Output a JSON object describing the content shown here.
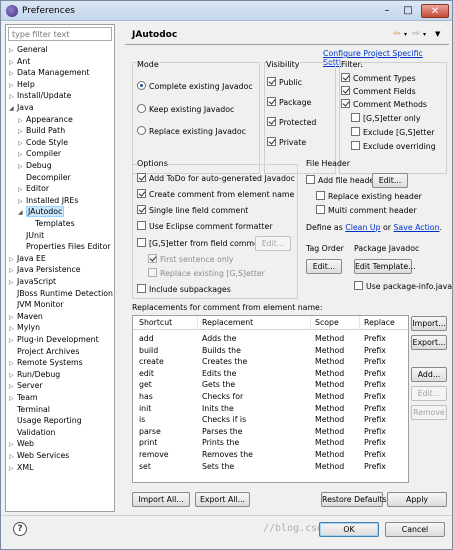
{
  "window": {
    "title": "Preferences"
  },
  "filter": {
    "placeholder": "type filter text"
  },
  "tree": [
    {
      "label": "General",
      "arrow": "▷",
      "indent": 0
    },
    {
      "label": "Ant",
      "arrow": "▷",
      "indent": 0
    },
    {
      "label": "Data Management",
      "arrow": "▷",
      "indent": 0
    },
    {
      "label": "Help",
      "arrow": "▷",
      "indent": 0
    },
    {
      "label": "Install/Update",
      "arrow": "▷",
      "indent": 0
    },
    {
      "label": "Java",
      "arrow": "◢",
      "indent": 0
    },
    {
      "label": "Appearance",
      "arrow": "▷",
      "indent": 1
    },
    {
      "label": "Build Path",
      "arrow": "▷",
      "indent": 1
    },
    {
      "label": "Code Style",
      "arrow": "▷",
      "indent": 1
    },
    {
      "label": "Compiler",
      "arrow": "▷",
      "indent": 1
    },
    {
      "label": "Debug",
      "arrow": "▷",
      "indent": 1
    },
    {
      "label": "Decompiler",
      "arrow": "",
      "indent": 1
    },
    {
      "label": "Editor",
      "arrow": "▷",
      "indent": 1
    },
    {
      "label": "Installed JREs",
      "arrow": "▷",
      "indent": 1
    },
    {
      "label": "JAutodoc",
      "arrow": "◢",
      "indent": 1,
      "selected": true
    },
    {
      "label": "Templates",
      "arrow": "",
      "indent": 2
    },
    {
      "label": "JUnit",
      "arrow": "",
      "indent": 1
    },
    {
      "label": "Properties Files Editor",
      "arrow": "",
      "indent": 1
    },
    {
      "label": "Java EE",
      "arrow": "▷",
      "indent": 0
    },
    {
      "label": "Java Persistence",
      "arrow": "▷",
      "indent": 0
    },
    {
      "label": "JavaScript",
      "arrow": "▷",
      "indent": 0
    },
    {
      "label": "JBoss Runtime Detection",
      "arrow": "",
      "indent": 0
    },
    {
      "label": "JVM Monitor",
      "arrow": "",
      "indent": 0
    },
    {
      "label": "Maven",
      "arrow": "▷",
      "indent": 0
    },
    {
      "label": "Mylyn",
      "arrow": "▷",
      "indent": 0
    },
    {
      "label": "Plug-in Development",
      "arrow": "▷",
      "indent": 0
    },
    {
      "label": "Project Archives",
      "arrow": "",
      "indent": 0
    },
    {
      "label": "Remote Systems",
      "arrow": "▷",
      "indent": 0
    },
    {
      "label": "Run/Debug",
      "arrow": "▷",
      "indent": 0
    },
    {
      "label": "Server",
      "arrow": "▷",
      "indent": 0
    },
    {
      "label": "Team",
      "arrow": "▷",
      "indent": 0
    },
    {
      "label": "Terminal",
      "arrow": "",
      "indent": 0
    },
    {
      "label": "Usage Reporting",
      "arrow": "",
      "indent": 0
    },
    {
      "label": "Validation",
      "arrow": "",
      "indent": 0
    },
    {
      "label": "Web",
      "arrow": "▷",
      "indent": 0
    },
    {
      "label": "Web Services",
      "arrow": "▷",
      "indent": 0
    },
    {
      "label": "XML",
      "arrow": "▷",
      "indent": 0
    }
  ],
  "page": {
    "title": "JAutodoc",
    "config_link": "Configure Project Specific Settings..."
  },
  "mode": {
    "title": "Mode",
    "options": [
      "Complete existing Javadoc",
      "Keep existing Javadoc",
      "Replace existing Javadoc"
    ],
    "selected": 0
  },
  "visibility": {
    "title": "Visibility",
    "public": "Public",
    "package": "Package",
    "protected": "Protected",
    "private": "Private"
  },
  "filter_group": {
    "title": "Filter",
    "comment_types": "Comment Types",
    "comment_fields": "Comment Fields",
    "comment_methods": "Comment Methods",
    "gs_only": "[G,S]etter only",
    "exclude_gs": "Exclude [G,S]etter",
    "exclude_overriding": "Exclude overriding"
  },
  "options": {
    "title": "Options",
    "add_todo": "Add ToDo for auto-generated Javadoc",
    "create_comment": "Create comment from element name",
    "single_line": "Single line field comment",
    "eclipse_formatter": "Use Eclipse comment formatter",
    "gs_from_field": "[G,S]etter from field comment",
    "edit": "Edit...",
    "first_sentence": "First sentence only",
    "replace_gs": "Replace existing [G,S]etter",
    "include_subpackages": "Include subpackages"
  },
  "file_header": {
    "title": "File Header",
    "add": "Add file header",
    "edit": "Edit...",
    "replace": "Replace existing header",
    "multi": "Multi comment header",
    "define_prefix": "Define as",
    "clean_up": "Clean Up",
    "or": "or",
    "save_action": "Save Action",
    "period": "."
  },
  "tag_order": {
    "title": "Tag Order",
    "edit": "Edit..."
  },
  "package_javadoc": {
    "title": "Package Javadoc",
    "edit_template": "Edit Template...",
    "use_package_info": "Use package-info.java"
  },
  "replacements": {
    "title": "Replacements for comment from element name:",
    "columns": [
      "Shortcut",
      "Replacement",
      "Scope",
      "Replace"
    ],
    "rows": [
      [
        "add",
        "Adds the",
        "Method",
        "Prefix"
      ],
      [
        "build",
        "Builds the",
        "Method",
        "Prefix"
      ],
      [
        "create",
        "Creates the",
        "Method",
        "Prefix"
      ],
      [
        "edit",
        "Edits the",
        "Method",
        "Prefix"
      ],
      [
        "get",
        "Gets the",
        "Method",
        "Prefix"
      ],
      [
        "has",
        "Checks for",
        "Method",
        "Prefix"
      ],
      [
        "init",
        "Inits the",
        "Method",
        "Prefix"
      ],
      [
        "is",
        "Checks if is",
        "Method",
        "Prefix"
      ],
      [
        "parse",
        "Parses the",
        "Method",
        "Prefix"
      ],
      [
        "print",
        "Prints the",
        "Method",
        "Prefix"
      ],
      [
        "remove",
        "Removes the",
        "Method",
        "Prefix"
      ],
      [
        "set",
        "Sets the",
        "Method",
        "Prefix"
      ]
    ],
    "import": "Import...",
    "export": "Export...",
    "add": "Add...",
    "edit": "Edit...",
    "remove": "Remove"
  },
  "footer": {
    "import_all": "Import All...",
    "export_all": "Export All...",
    "restore_defaults": "Restore Defaults",
    "apply": "Apply",
    "ok": "OK",
    "cancel": "Cancel",
    "help": "?"
  },
  "watermark": "//blog.csdn.ne"
}
